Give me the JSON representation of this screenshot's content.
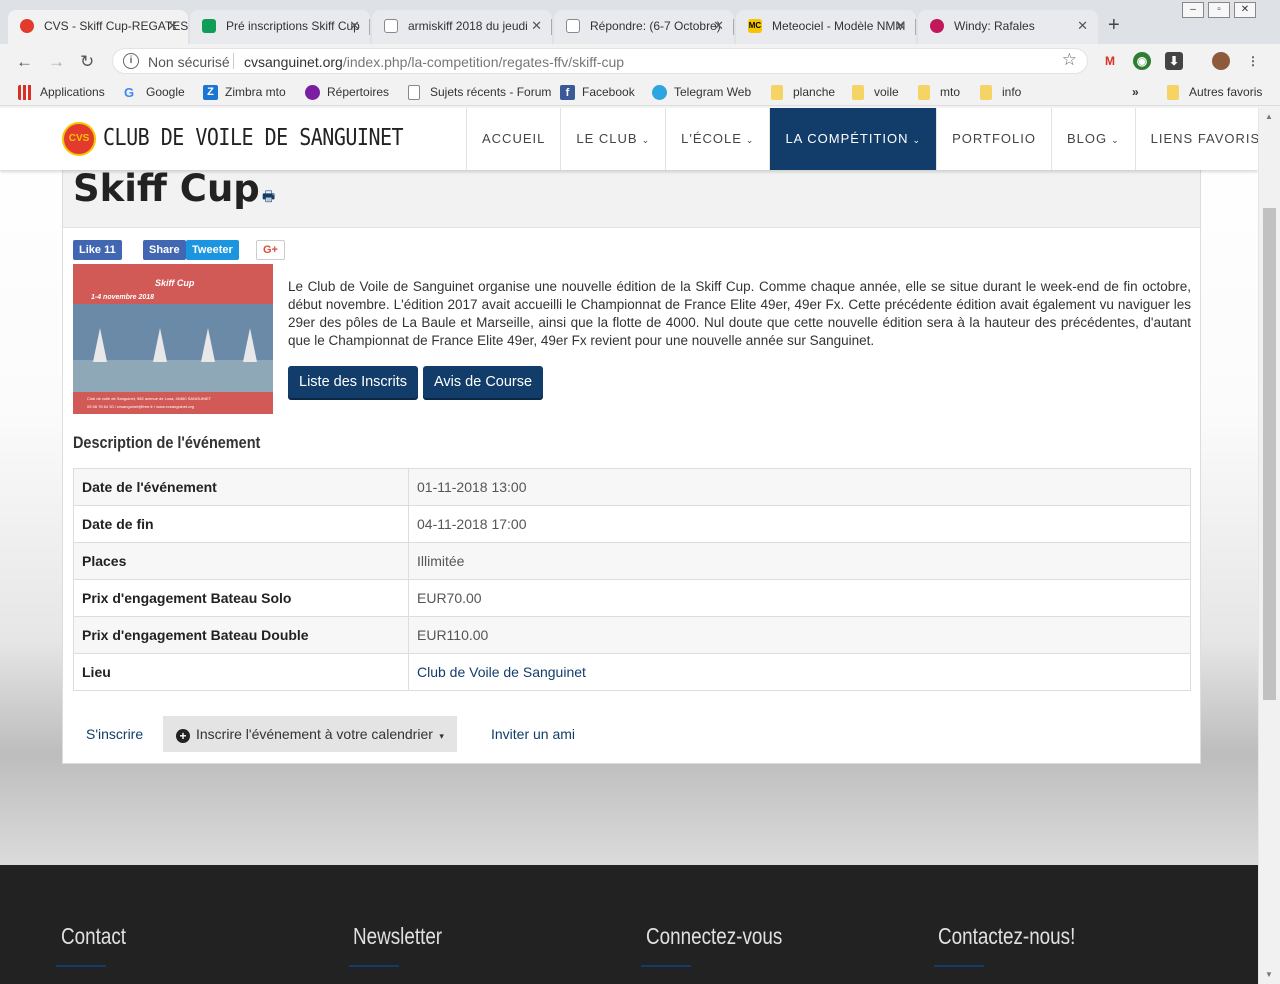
{
  "browser": {
    "tabs": [
      {
        "title": "CVS - Skiff Cup-REGATES",
        "icon": "cvs-favicon",
        "color": "#e23b2e"
      },
      {
        "title": "Pré inscriptions Skiff Cup",
        "icon": "sheets-icon",
        "color": "#0f9d58"
      },
      {
        "title": "armiskiff 2018 du jeudi",
        "icon": "doc-icon",
        "color": "#888888"
      },
      {
        "title": "Répondre: (6-7 Octobre)",
        "icon": "doc-icon",
        "color": "#888888"
      },
      {
        "title": "Meteociel - Modèle NMM",
        "icon": "mc-icon",
        "color": "#f5c500"
      },
      {
        "title": "Windy: Rafales",
        "icon": "windy-icon",
        "color": "#c2185b"
      }
    ],
    "new_tab": "+",
    "security_label": "Non sécurisé",
    "url_domain": "cvsanguinet.org",
    "url_path": "/index.php/la-competition/regates-ffv/skiff-cup",
    "bookmarks": [
      {
        "label": "Applications",
        "icon": "apps-grid-icon"
      },
      {
        "label": "Google",
        "icon": "google-icon"
      },
      {
        "label": "Zimbra mto",
        "icon": "zimbra-icon"
      },
      {
        "label": "Répertoires",
        "icon": "directory-icon"
      },
      {
        "label": "Sujets récents - Forum",
        "icon": "doc-icon"
      },
      {
        "label": "Facebook",
        "icon": "facebook-icon"
      },
      {
        "label": "Telegram Web",
        "icon": "telegram-icon"
      },
      {
        "label": "planche",
        "icon": "folder-icon"
      },
      {
        "label": "voile",
        "icon": "folder-icon"
      },
      {
        "label": "mto",
        "icon": "folder-icon"
      },
      {
        "label": "info",
        "icon": "folder-icon"
      }
    ],
    "more_bookmarks": "»",
    "other_bookmarks": "Autres favoris"
  },
  "site": {
    "logo_text": "CVS",
    "name": "CLUB DE VOILE DE SANGUINET",
    "nav": [
      {
        "label": "ACCUEIL",
        "caret": false,
        "active": false
      },
      {
        "label": "LE CLUB",
        "caret": true,
        "active": false
      },
      {
        "label": "L'ÉCOLE",
        "caret": true,
        "active": false
      },
      {
        "label": "LA COMPÉTITION",
        "caret": true,
        "active": true
      },
      {
        "label": "PORTFOLIO",
        "caret": false,
        "active": false
      },
      {
        "label": "BLOG",
        "caret": true,
        "active": false
      },
      {
        "label": "LIENS FAVORIS",
        "caret": false,
        "active": false
      }
    ],
    "accent_color": "#123d6a"
  },
  "event": {
    "title": "Skiff Cup",
    "social": {
      "like": "Like 11",
      "share": "Share",
      "tweet": "Tweeter",
      "gplus": "G+"
    },
    "image": {
      "title": "Skiff Cup",
      "date": "1-4 novembre 2018",
      "line1": "Club de voile de Sanguinet, 982 avenue de Losa, 40460 SANGUINET",
      "line2": "05 58 78 64 30 / cvsanguinet@free.fr / www.cvsanguinet.org"
    },
    "description": "Le Club de Voile de Sanguinet organise une nouvelle édition de la Skiff Cup. Comme chaque année, elle se situe durant le week-end de fin octobre, début novembre. L'édition 2017 avait accueilli le Championnat de France Elite 49er, 49er Fx. Cette précédente édition avait également vu naviguer les 29er des pôles de La Baule et Marseille, ainsi que la flotte de 4000. Nul doute que cette nouvelle édition sera à la hauteur des précédentes, d'autant que le Championnat de France Elite 49er, 49er Fx revient pour une nouvelle année sur Sanguinet.",
    "buttons": {
      "registered": "Liste des Inscrits",
      "notice": "Avis de Course"
    },
    "details_heading": "Description de l'événement",
    "details": [
      {
        "label": "Date de l'événement",
        "value": "01-11-2018 13:00"
      },
      {
        "label": "Date de fin",
        "value": "04-11-2018 17:00"
      },
      {
        "label": "Places",
        "value": "Illimitée"
      },
      {
        "label": "Prix d'engagement Bateau Solo",
        "value": "EUR70.00"
      },
      {
        "label": "Prix d'engagement Bateau Double",
        "value": "EUR110.00"
      },
      {
        "label": "Lieu",
        "value": "Club de Voile de Sanguinet"
      }
    ],
    "actions": {
      "register": "S'inscrire",
      "calendar": "Inscrire l'événement à votre calendrier",
      "invite": "Inviter un ami"
    }
  },
  "footer": {
    "columns": [
      "Contact",
      "Newsletter",
      "Connectez-vous",
      "Contactez-nous!"
    ]
  }
}
